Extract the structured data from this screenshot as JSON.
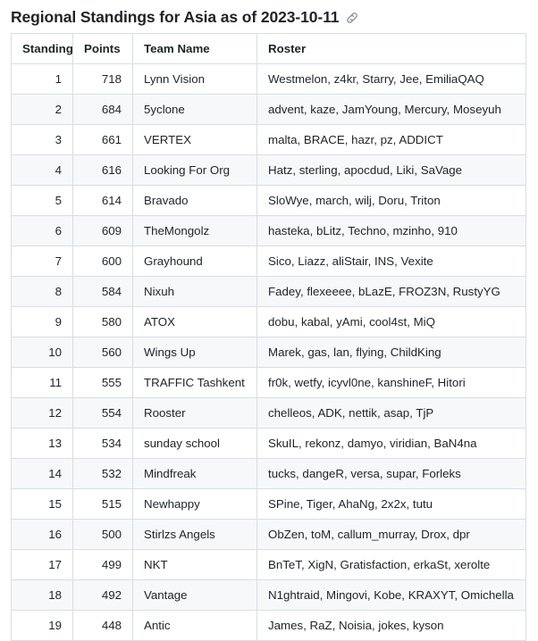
{
  "header": {
    "title": "Regional Standings for Asia as of 2023-10-11",
    "anchor_icon": "link-icon"
  },
  "table": {
    "columns": [
      "Standing",
      "Points",
      "Team Name",
      "Roster"
    ],
    "rows": [
      {
        "standing": "1",
        "points": "718",
        "team": "Lynn Vision",
        "roster": "Westmelon, z4kr, Starry, Jee, EmiliaQAQ"
      },
      {
        "standing": "2",
        "points": "684",
        "team": "5yclone",
        "roster": "advent, kaze, JamYoung, Mercury, Moseyuh"
      },
      {
        "standing": "3",
        "points": "661",
        "team": "VERTEX",
        "roster": "malta, BRACE, hazr, pz, ADDICT"
      },
      {
        "standing": "4",
        "points": "616",
        "team": "Looking For Org",
        "roster": "Hatz, sterling, apocdud, Liki, SaVage"
      },
      {
        "standing": "5",
        "points": "614",
        "team": "Bravado",
        "roster": "SloWye, march, wilj, Doru, Triton"
      },
      {
        "standing": "6",
        "points": "609",
        "team": "TheMongolz",
        "roster": "hasteka, bLitz, Techno, mzinho, 910"
      },
      {
        "standing": "7",
        "points": "600",
        "team": "Grayhound",
        "roster": "Sico, Liazz, aliStair, INS, Vexite"
      },
      {
        "standing": "8",
        "points": "584",
        "team": "Nixuh",
        "roster": "Fadey, flexeeee, bLazE, FROZ3N, RustyYG"
      },
      {
        "standing": "9",
        "points": "580",
        "team": "ATOX",
        "roster": "dobu, kabal, yAmi, cool4st, MiQ"
      },
      {
        "standing": "10",
        "points": "560",
        "team": "Wings Up",
        "roster": "Marek, gas, lan, flying, ChildKing"
      },
      {
        "standing": "11",
        "points": "555",
        "team": "TRAFFIC Tashkent",
        "roster": "fr0k, wetfy, icyvl0ne, kanshineF, Hitori"
      },
      {
        "standing": "12",
        "points": "554",
        "team": "Rooster",
        "roster": "chelleos, ADK, nettik, asap, TjP"
      },
      {
        "standing": "13",
        "points": "534",
        "team": "sunday school",
        "roster": "SkuIL, rekonz, damyo, viridian, BaN4na"
      },
      {
        "standing": "14",
        "points": "532",
        "team": "Mindfreak",
        "roster": "tucks, dangeR, versa, supar, Forleks"
      },
      {
        "standing": "15",
        "points": "515",
        "team": "Newhappy",
        "roster": "SPine, Tiger, AhaNg, 2x2x, tutu"
      },
      {
        "standing": "16",
        "points": "500",
        "team": "Stirlzs Angels",
        "roster": "ObZen, toM, callum_murray, Drox, dpr"
      },
      {
        "standing": "17",
        "points": "499",
        "team": "NKT",
        "roster": "BnTeT, XigN, Gratisfaction, erkaSt, xerolte"
      },
      {
        "standing": "18",
        "points": "492",
        "team": "Vantage",
        "roster": "N1ghtraid, Mingovi, Kobe, KRAXYT, Omichella"
      },
      {
        "standing": "19",
        "points": "448",
        "team": "Antic",
        "roster": "James, RaZ, Noisia, jokes, kyson"
      }
    ]
  },
  "colors": {
    "text": "#1f2328",
    "border": "#d8dee4",
    "stripe": "#f6f8fa",
    "icon": "#8b949e"
  }
}
